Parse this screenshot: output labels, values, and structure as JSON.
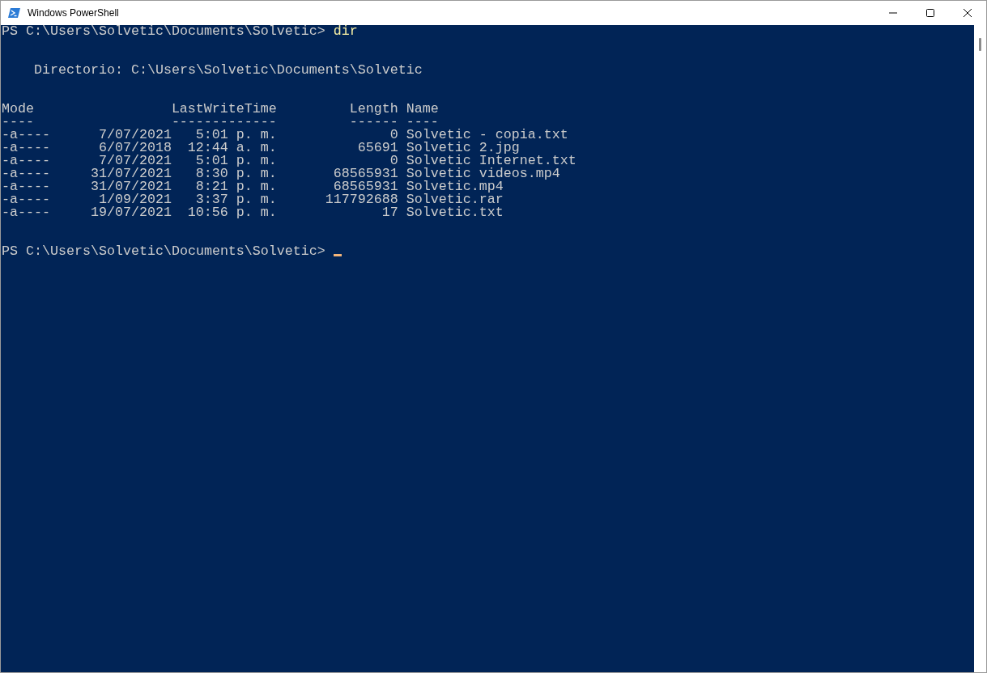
{
  "window": {
    "title": "Windows PowerShell"
  },
  "console": {
    "first_prompt": "PS C:\\Users\\Solvetic\\Documents\\Solvetic>",
    "command": "dir",
    "directory_line": "Directorio: C:\\Users\\Solvetic\\Documents\\Solvetic",
    "table": {
      "columns": [
        "Mode",
        "LastWriteTime",
        "Length",
        "Name"
      ],
      "underlines": [
        "----",
        "-------------",
        "------",
        "----"
      ],
      "rows": [
        {
          "mode": "-a----",
          "date": "7/07/2021",
          "time": "5:01 p. m.",
          "length": "0",
          "name": "Solvetic - copia.txt"
        },
        {
          "mode": "-a----",
          "date": "6/07/2018",
          "time": "12:44 a. m.",
          "length": "65691",
          "name": "Solvetic 2.jpg"
        },
        {
          "mode": "-a----",
          "date": "7/07/2021",
          "time": "5:01 p. m.",
          "length": "0",
          "name": "Solvetic Internet.txt"
        },
        {
          "mode": "-a----",
          "date": "31/07/2021",
          "time": "8:30 p. m.",
          "length": "68565931",
          "name": "Solvetic videos.mp4"
        },
        {
          "mode": "-a----",
          "date": "31/07/2021",
          "time": "8:21 p. m.",
          "length": "68565931",
          "name": "Solvetic.mp4"
        },
        {
          "mode": "-a----",
          "date": "1/09/2021",
          "time": "3:37 p. m.",
          "length": "117792688",
          "name": "Solvetic.rar"
        },
        {
          "mode": "-a----",
          "date": "19/07/2021",
          "time": "10:56 p. m.",
          "length": "17",
          "name": "Solvetic.txt"
        }
      ]
    },
    "last_prompt": "PS C:\\Users\\Solvetic\\Documents\\Solvetic>",
    "cursor_visible": true
  }
}
